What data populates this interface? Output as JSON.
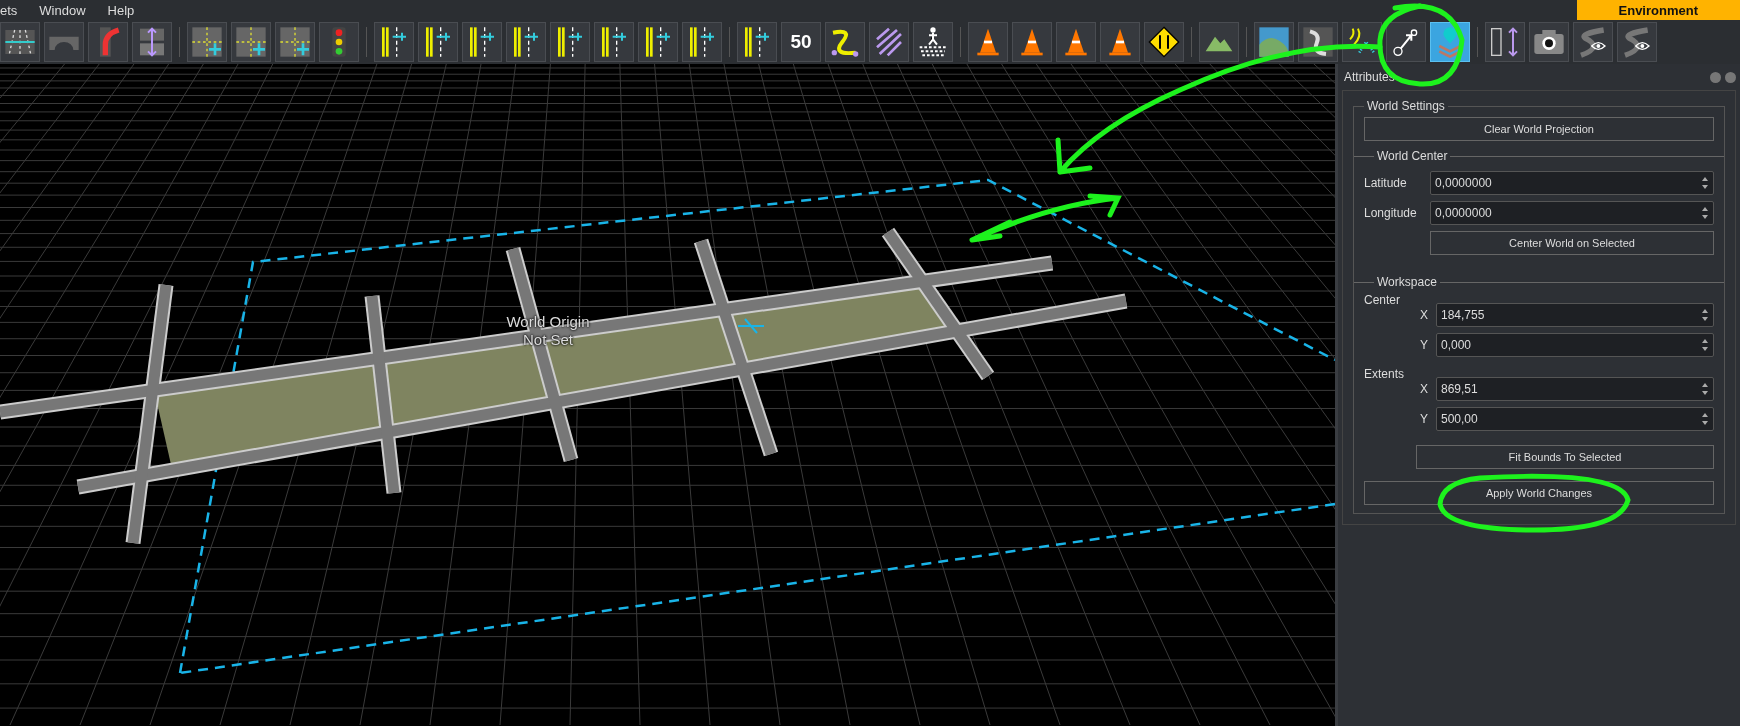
{
  "menu": [
    "ets",
    "Window",
    "Help"
  ],
  "environment_tab": "Environment",
  "toolbar": {
    "groups": [
      [
        {
          "selected": false
        },
        {
          "selected": false
        },
        {
          "selected": false
        },
        {
          "selected": false
        }
      ],
      [
        {
          "selected": false
        },
        {
          "selected": false
        },
        {
          "selected": false
        },
        {
          "selected": false
        }
      ],
      [
        {
          "selected": false
        },
        {
          "selected": false
        },
        {
          "selected": false
        },
        {
          "selected": false
        },
        {
          "selected": false
        },
        {
          "selected": false
        },
        {
          "selected": false
        },
        {
          "selected": false
        }
      ],
      [
        {
          "selected": false
        },
        {
          "selected": false,
          "label": "50"
        },
        {
          "selected": false
        },
        {
          "selected": false
        },
        {
          "selected": false
        }
      ],
      [
        {
          "selected": false
        },
        {
          "selected": false
        },
        {
          "selected": false
        },
        {
          "selected": false
        },
        {
          "selected": false
        }
      ],
      [
        {
          "selected": false
        }
      ],
      [
        {
          "selected": false
        },
        {
          "selected": false
        },
        {
          "selected": false
        },
        {
          "selected": false
        },
        {
          "selected": true
        }
      ],
      [
        {
          "selected": false
        },
        {
          "selected": false
        },
        {
          "selected": false
        },
        {
          "selected": false
        }
      ]
    ]
  },
  "viewport": {
    "label": "World Origin Not Set"
  },
  "panel": {
    "title": "Attributes",
    "world_settings": {
      "title": "World Settings",
      "button": "Clear World Projection"
    },
    "world_center": {
      "title": "World Center",
      "fields": [
        {
          "label": "Latitude",
          "value": "0,0000000"
        },
        {
          "label": "Longitude",
          "value": "0,0000000"
        }
      ],
      "button": "Center World on Selected"
    },
    "workspace": {
      "title": "Workspace",
      "groups": [
        {
          "label": "Center",
          "fields": [
            {
              "axis": "X",
              "value": "184,755"
            },
            {
              "axis": "Y",
              "value": "0,000"
            }
          ]
        },
        {
          "label": "Extents",
          "fields": [
            {
              "axis": "X",
              "value": "869,51"
            },
            {
              "axis": "Y",
              "value": "500,00"
            }
          ]
        }
      ],
      "button": "Fit Bounds To Selected"
    },
    "apply_button": "Apply World Changes"
  }
}
